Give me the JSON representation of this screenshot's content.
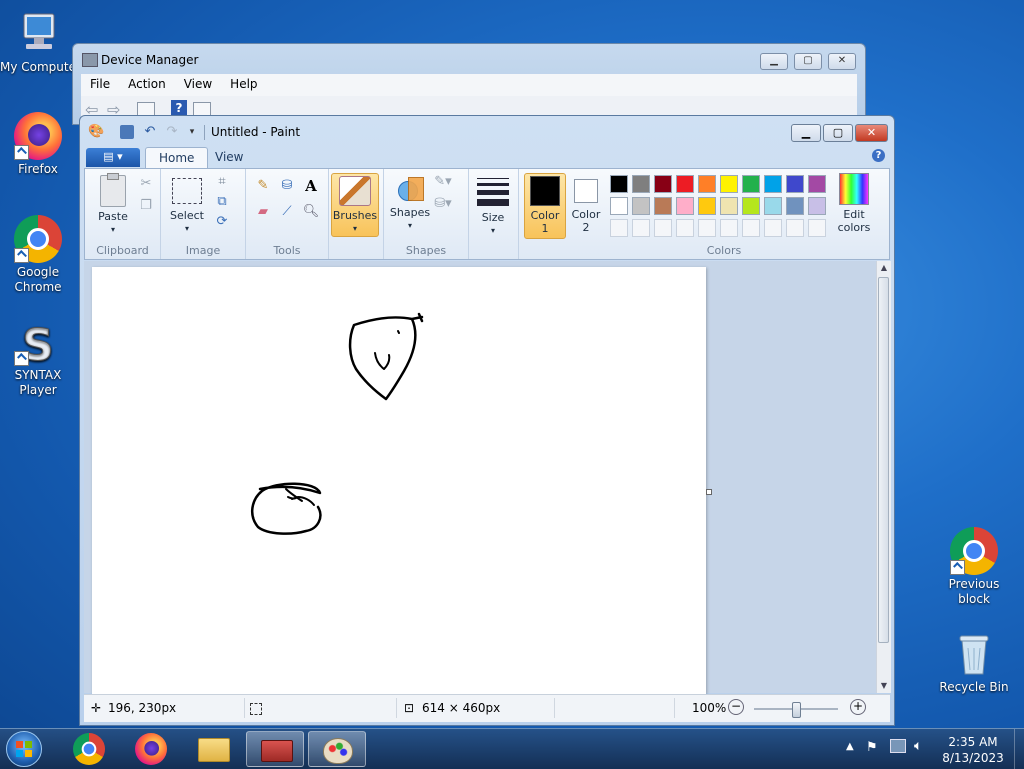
{
  "desktop": {
    "icons": [
      {
        "label": "My Compute",
        "name": "my-computer"
      },
      {
        "label": "Firefox",
        "name": "firefox"
      },
      {
        "label": "Google Chrome",
        "name": "google-chrome"
      },
      {
        "label": "SYNTAX Player",
        "name": "syntax-player"
      },
      {
        "label": "Previous block",
        "name": "previous-block"
      },
      {
        "label": "Recycle Bin",
        "name": "recycle-bin"
      }
    ]
  },
  "device_manager": {
    "title": "Device Manager",
    "menu": [
      "File",
      "Action",
      "View",
      "Help"
    ]
  },
  "paint": {
    "title": "Untitled - Paint",
    "tabs": [
      "Home",
      "View"
    ],
    "groups": {
      "clipboard": {
        "label": "Clipboard",
        "paste": "Paste"
      },
      "image": {
        "label": "Image",
        "select": "Select"
      },
      "tools": {
        "label": "Tools"
      },
      "brushes": "Brushes",
      "shapes": {
        "label": "Shapes",
        "button": "Shapes"
      },
      "size": "Size",
      "color1": "Color 1",
      "color2": "Color 2",
      "colors": {
        "label": "Colors",
        "edit": "Edit colors"
      }
    },
    "palette_row1": [
      "#000000",
      "#7f7f7f",
      "#880015",
      "#ed1c24",
      "#ff7f27",
      "#fff200",
      "#22b14c",
      "#00a2e8",
      "#3f48cc",
      "#a349a4"
    ],
    "palette_row2": [
      "#ffffff",
      "#c3c3c3",
      "#b97a57",
      "#ffaec9",
      "#ffc90e",
      "#efe4b0",
      "#b5e61d",
      "#99d9ea",
      "#7092be",
      "#c8bfe7"
    ],
    "color1_value": "#000000",
    "color2_value": "#ffffff",
    "status": {
      "cursor_pos": "196, 230px",
      "canvas_size": "614 × 460px",
      "zoom": "100%"
    }
  },
  "taskbar": {
    "time": "2:35 AM",
    "date": "8/13/2023"
  }
}
